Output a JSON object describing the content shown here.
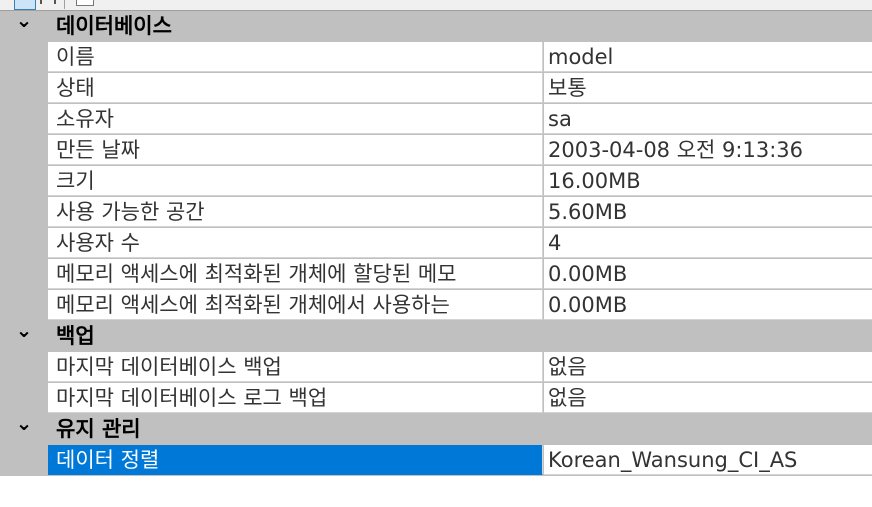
{
  "colors": {
    "category_background": "#c0c0c0",
    "selection": "#0078d7",
    "row_background": "#ffffff"
  },
  "toolbar": {
    "icons": [
      "categorized-icon",
      "alphabetical-icon",
      "property-pages-icon"
    ]
  },
  "categories": [
    {
      "label": "데이터베이스",
      "rows": [
        {
          "name": "이름",
          "value": "model"
        },
        {
          "name": "상태",
          "value": "보통"
        },
        {
          "name": "소유자",
          "value": "sa"
        },
        {
          "name": "만든 날짜",
          "value": "2003-04-08 오전 9:13:36"
        },
        {
          "name": "크기",
          "value": "16.00MB"
        },
        {
          "name": "사용 가능한 공간",
          "value": "5.60MB"
        },
        {
          "name": "사용자 수",
          "value": "4"
        },
        {
          "name": "메모리 액세스에 최적화된 개체에 할당된 메모",
          "value": "0.00MB"
        },
        {
          "name": "메모리 액세스에 최적화된 개체에서 사용하는",
          "value": "0.00MB"
        }
      ]
    },
    {
      "label": "백업",
      "rows": [
        {
          "name": "마지막 데이터베이스 백업",
          "value": "없음"
        },
        {
          "name": "마지막 데이터베이스 로그 백업",
          "value": "없음"
        }
      ]
    },
    {
      "label": "유지 관리",
      "rows": [
        {
          "name": "데이터 정렬",
          "value": "Korean_Wansung_CI_AS",
          "selected": true
        }
      ]
    }
  ]
}
